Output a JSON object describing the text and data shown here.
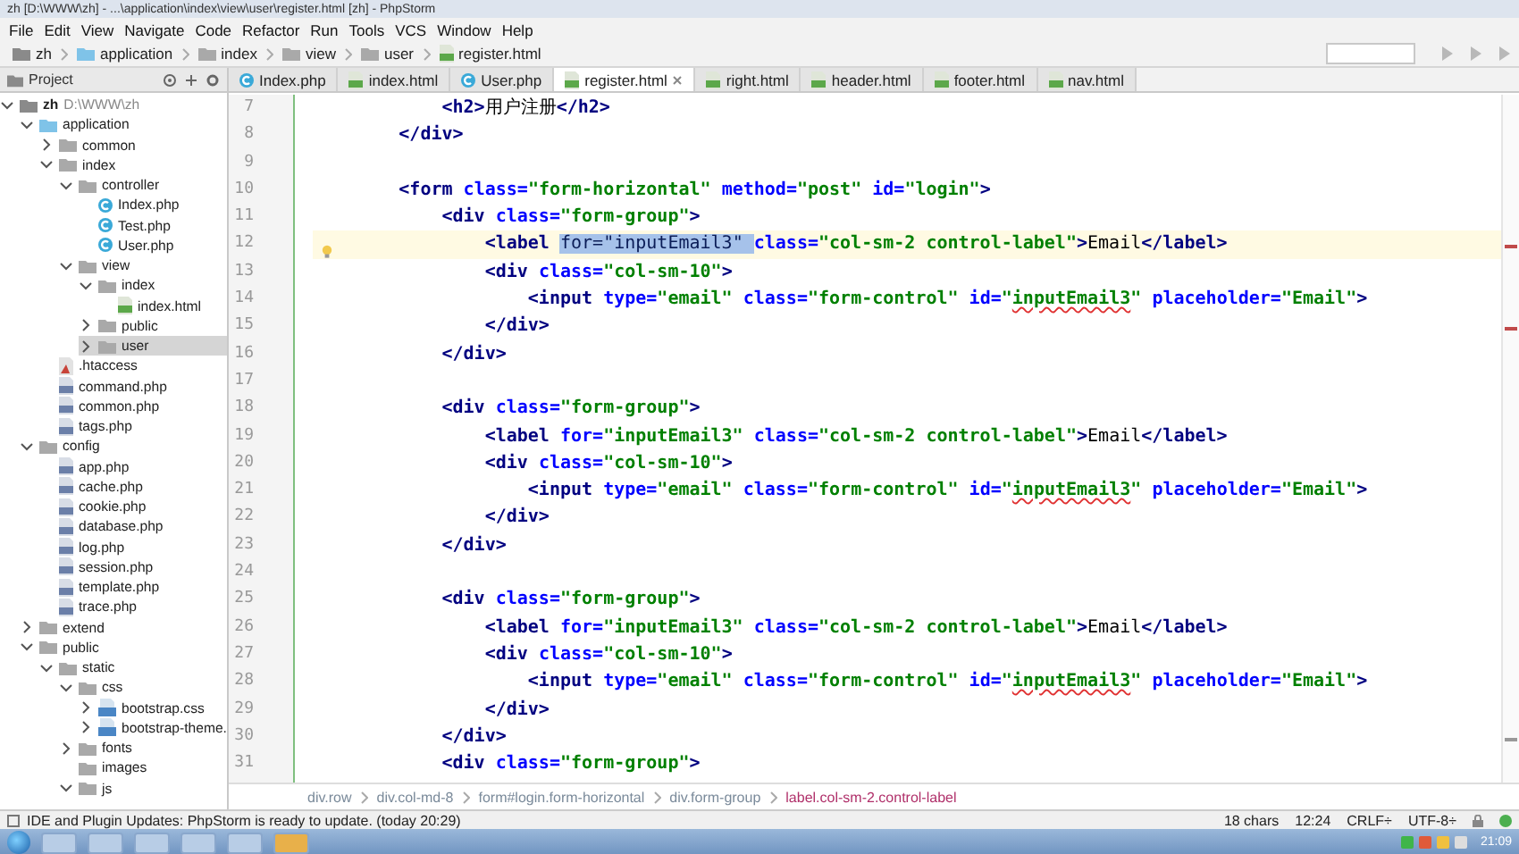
{
  "window": {
    "title": "zh [D:\\WWW\\zh] - ...\\application\\index\\view\\user\\register.html [zh] - PhpStorm"
  },
  "menu": [
    "File",
    "Edit",
    "View",
    "Navigate",
    "Code",
    "Refactor",
    "Run",
    "Tools",
    "VCS",
    "Window",
    "Help"
  ],
  "navigation_bar": [
    {
      "label": "zh",
      "kind": "project"
    },
    {
      "label": "application",
      "kind": "module"
    },
    {
      "label": "index",
      "kind": "folder"
    },
    {
      "label": "view",
      "kind": "folder"
    },
    {
      "label": "user",
      "kind": "folder"
    },
    {
      "label": "register.html",
      "kind": "html"
    }
  ],
  "project_panel": {
    "title": "Project"
  },
  "tabs": [
    {
      "label": "Index.php",
      "kind": "php-class",
      "selected": false
    },
    {
      "label": "index.html",
      "kind": "html",
      "selected": false
    },
    {
      "label": "User.php",
      "kind": "php-class",
      "selected": false
    },
    {
      "label": "register.html",
      "kind": "html",
      "selected": true
    },
    {
      "label": "right.html",
      "kind": "html",
      "selected": false
    },
    {
      "label": "header.html",
      "kind": "html",
      "selected": false
    },
    {
      "label": "footer.html",
      "kind": "html",
      "selected": false
    },
    {
      "label": "nav.html",
      "kind": "html",
      "selected": false
    }
  ],
  "tree": [
    {
      "label": "zh",
      "path": "D:\\WWW\\zh",
      "kind": "project",
      "expanded": true,
      "selected": false,
      "children": [
        {
          "label": "application",
          "kind": "module",
          "expanded": true,
          "selected": false,
          "children": [
            {
              "label": "common",
              "kind": "folder",
              "expanded": false,
              "selected": false
            },
            {
              "label": "index",
              "kind": "folder",
              "expanded": true,
              "selected": false,
              "children": [
                {
                  "label": "controller",
                  "kind": "folder",
                  "expanded": true,
                  "selected": false,
                  "children": [
                    {
                      "label": "Index.php",
                      "kind": "php-class",
                      "selected": false
                    },
                    {
                      "label": "Test.php",
                      "kind": "php-class",
                      "selected": false
                    },
                    {
                      "label": "User.php",
                      "kind": "php-class",
                      "selected": false
                    }
                  ]
                },
                {
                  "label": "view",
                  "kind": "folder",
                  "expanded": true,
                  "selected": false,
                  "children": [
                    {
                      "label": "index",
                      "kind": "folder",
                      "expanded": true,
                      "selected": false,
                      "children": [
                        {
                          "label": "index.html",
                          "kind": "html",
                          "selected": false
                        }
                      ]
                    },
                    {
                      "label": "public",
                      "kind": "folder",
                      "expanded": false,
                      "selected": false
                    },
                    {
                      "label": "user",
                      "kind": "folder",
                      "expanded": false,
                      "selected": true
                    }
                  ]
                }
              ]
            },
            {
              "label": ".htaccess",
              "kind": "htaccess",
              "selected": false
            },
            {
              "label": "command.php",
              "kind": "php",
              "selected": false
            },
            {
              "label": "common.php",
              "kind": "php",
              "selected": false
            },
            {
              "label": "tags.php",
              "kind": "php",
              "selected": false
            }
          ]
        },
        {
          "label": "config",
          "kind": "folder",
          "expanded": true,
          "selected": false,
          "children": [
            {
              "label": "app.php",
              "kind": "php",
              "selected": false
            },
            {
              "label": "cache.php",
              "kind": "php",
              "selected": false
            },
            {
              "label": "cookie.php",
              "kind": "php",
              "selected": false
            },
            {
              "label": "database.php",
              "kind": "php",
              "selected": false
            },
            {
              "label": "log.php",
              "kind": "php",
              "selected": false
            },
            {
              "label": "session.php",
              "kind": "php",
              "selected": false
            },
            {
              "label": "template.php",
              "kind": "php",
              "selected": false
            },
            {
              "label": "trace.php",
              "kind": "php",
              "selected": false
            }
          ]
        },
        {
          "label": "extend",
          "kind": "folder",
          "expanded": false,
          "selected": false
        },
        {
          "label": "public",
          "kind": "folder",
          "expanded": true,
          "selected": false,
          "children": [
            {
              "label": "static",
              "kind": "folder",
              "expanded": true,
              "selected": false,
              "children": [
                {
                  "label": "css",
                  "kind": "folder",
                  "expanded": true,
                  "selected": false,
                  "children": [
                    {
                      "label": "bootstrap.css",
                      "kind": "css",
                      "expanded": false,
                      "selected": false
                    },
                    {
                      "label": "bootstrap-theme.",
                      "kind": "css",
                      "expanded": false,
                      "selected": false
                    }
                  ]
                },
                {
                  "label": "fonts",
                  "kind": "folder",
                  "expanded": false,
                  "selected": false
                },
                {
                  "label": "images",
                  "kind": "folder",
                  "selected": false
                },
                {
                  "label": "js",
                  "kind": "folder",
                  "expanded": true,
                  "selected": false
                }
              ]
            }
          ]
        }
      ]
    }
  ],
  "editor": {
    "lines": [
      {
        "number": "7",
        "current": false,
        "tokens": [
          {
            "kind": "tag",
            "text": "            <h2>"
          },
          {
            "kind": "text",
            "text": "用户注册"
          },
          {
            "kind": "tag",
            "text": "</h2>"
          }
        ]
      },
      {
        "number": "8",
        "current": false,
        "tokens": [
          {
            "kind": "tag",
            "text": "        </div>"
          }
        ]
      },
      {
        "number": "9",
        "current": false
      },
      {
        "number": "10",
        "current": false,
        "tokens": [
          {
            "kind": "tag",
            "text": "        <form"
          },
          {
            "kind": "attr",
            "text": " class="
          },
          {
            "kind": "value",
            "text": "\"form-horizontal\""
          },
          {
            "kind": "attr",
            "text": " method="
          },
          {
            "kind": "value",
            "text": "\"post\""
          },
          {
            "kind": "attr",
            "text": " id="
          },
          {
            "kind": "value",
            "text": "\"login\""
          },
          {
            "kind": "tag",
            "text": ">"
          }
        ]
      },
      {
        "number": "11",
        "current": false,
        "tokens": [
          {
            "kind": "tag",
            "text": "            <div"
          },
          {
            "kind": "attr",
            "text": " class="
          },
          {
            "kind": "value",
            "text": "\"form-group\""
          },
          {
            "kind": "tag",
            "text": ">"
          }
        ]
      },
      {
        "number": "12",
        "current": true,
        "tokens": [
          {
            "kind": "tag",
            "text": "                <label "
          },
          {
            "kind": "selection",
            "text": "for=\"inputEmail3\" "
          },
          {
            "kind": "attr",
            "text": "class="
          },
          {
            "kind": "value",
            "text": "\"col-sm-2 control-label\""
          },
          {
            "kind": "tag",
            "text": ">"
          },
          {
            "kind": "text",
            "text": "Email"
          },
          {
            "kind": "tag",
            "text": "</label>"
          }
        ]
      },
      {
        "number": "13",
        "current": false,
        "tokens": [
          {
            "kind": "tag",
            "text": "                <div"
          },
          {
            "kind": "attr",
            "text": " class="
          },
          {
            "kind": "value",
            "text": "\"col-sm-10\""
          },
          {
            "kind": "tag",
            "text": ">"
          }
        ]
      },
      {
        "number": "14",
        "current": false,
        "tokens": [
          {
            "kind": "tag",
            "text": "                    <input"
          },
          {
            "kind": "attr",
            "text": " type="
          },
          {
            "kind": "value",
            "text": "\"email\""
          },
          {
            "kind": "attr",
            "text": " class="
          },
          {
            "kind": "value",
            "text": "\"form-control\""
          },
          {
            "kind": "attr",
            "text": " id="
          },
          {
            "kind": "value",
            "text": "\""
          },
          {
            "kind": "typo",
            "text": "inputEmail3"
          },
          {
            "kind": "value",
            "text": "\""
          },
          {
            "kind": "attr",
            "text": " placeholder="
          },
          {
            "kind": "value",
            "text": "\"Email\""
          },
          {
            "kind": "tag",
            "text": ">"
          }
        ]
      },
      {
        "number": "15",
        "current": false,
        "tokens": [
          {
            "kind": "tag",
            "text": "                </div>"
          }
        ]
      },
      {
        "number": "16",
        "current": false,
        "tokens": [
          {
            "kind": "tag",
            "text": "            </div>"
          }
        ]
      },
      {
        "number": "17",
        "current": false
      },
      {
        "number": "18",
        "current": false,
        "tokens": [
          {
            "kind": "tag",
            "text": "            <div"
          },
          {
            "kind": "attr",
            "text": " class="
          },
          {
            "kind": "value",
            "text": "\"form-group\""
          },
          {
            "kind": "tag",
            "text": ">"
          }
        ]
      },
      {
        "number": "19",
        "current": false,
        "tokens": [
          {
            "kind": "tag",
            "text": "                <label"
          },
          {
            "kind": "attr",
            "text": " for="
          },
          {
            "kind": "value",
            "text": "\"inputEmail3\""
          },
          {
            "kind": "attr",
            "text": " class="
          },
          {
            "kind": "value",
            "text": "\"col-sm-2 control-label\""
          },
          {
            "kind": "tag",
            "text": ">"
          },
          {
            "kind": "text",
            "text": "Email"
          },
          {
            "kind": "tag",
            "text": "</label>"
          }
        ]
      },
      {
        "number": "20",
        "current": false,
        "tokens": [
          {
            "kind": "tag",
            "text": "                <div"
          },
          {
            "kind": "attr",
            "text": " class="
          },
          {
            "kind": "value",
            "text": "\"col-sm-10\""
          },
          {
            "kind": "tag",
            "text": ">"
          }
        ]
      },
      {
        "number": "21",
        "current": false,
        "tokens": [
          {
            "kind": "tag",
            "text": "                    <input"
          },
          {
            "kind": "attr",
            "text": " type="
          },
          {
            "kind": "value",
            "text": "\"email\""
          },
          {
            "kind": "attr",
            "text": " class="
          },
          {
            "kind": "value",
            "text": "\"form-control\""
          },
          {
            "kind": "attr",
            "text": " id="
          },
          {
            "kind": "value",
            "text": "\""
          },
          {
            "kind": "typo",
            "text": "inputEmail3"
          },
          {
            "kind": "value",
            "text": "\""
          },
          {
            "kind": "attr",
            "text": " placeholder="
          },
          {
            "kind": "value",
            "text": "\"Email\""
          },
          {
            "kind": "tag",
            "text": ">"
          }
        ]
      },
      {
        "number": "22",
        "current": false,
        "tokens": [
          {
            "kind": "tag",
            "text": "                </div>"
          }
        ]
      },
      {
        "number": "23",
        "current": false,
        "tokens": [
          {
            "kind": "tag",
            "text": "            </div>"
          }
        ]
      },
      {
        "number": "24",
        "current": false
      },
      {
        "number": "25",
        "current": false,
        "tokens": [
          {
            "kind": "tag",
            "text": "            <div"
          },
          {
            "kind": "attr",
            "text": " class="
          },
          {
            "kind": "value",
            "text": "\"form-group\""
          },
          {
            "kind": "tag",
            "text": ">"
          }
        ]
      },
      {
        "number": "26",
        "current": false,
        "tokens": [
          {
            "kind": "tag",
            "text": "                <label"
          },
          {
            "kind": "attr",
            "text": " for="
          },
          {
            "kind": "value",
            "text": "\"inputEmail3\""
          },
          {
            "kind": "attr",
            "text": " class="
          },
          {
            "kind": "value",
            "text": "\"col-sm-2 control-label\""
          },
          {
            "kind": "tag",
            "text": ">"
          },
          {
            "kind": "text",
            "text": "Email"
          },
          {
            "kind": "tag",
            "text": "</label>"
          }
        ]
      },
      {
        "number": "27",
        "current": false,
        "tokens": [
          {
            "kind": "tag",
            "text": "                <div"
          },
          {
            "kind": "attr",
            "text": " class="
          },
          {
            "kind": "value",
            "text": "\"col-sm-10\""
          },
          {
            "kind": "tag",
            "text": ">"
          }
        ]
      },
      {
        "number": "28",
        "current": false,
        "tokens": [
          {
            "kind": "tag",
            "text": "                    <input"
          },
          {
            "kind": "attr",
            "text": " type="
          },
          {
            "kind": "value",
            "text": "\"email\""
          },
          {
            "kind": "attr",
            "text": " class="
          },
          {
            "kind": "value",
            "text": "\"form-control\""
          },
          {
            "kind": "attr",
            "text": " id="
          },
          {
            "kind": "value",
            "text": "\""
          },
          {
            "kind": "typo",
            "text": "inputEmail3"
          },
          {
            "kind": "value",
            "text": "\""
          },
          {
            "kind": "attr",
            "text": " placeholder="
          },
          {
            "kind": "value",
            "text": "\"Email\""
          },
          {
            "kind": "tag",
            "text": ">"
          }
        ]
      },
      {
        "number": "29",
        "current": false,
        "tokens": [
          {
            "kind": "tag",
            "text": "                </div>"
          }
        ]
      },
      {
        "number": "30",
        "current": false,
        "tokens": [
          {
            "kind": "tag",
            "text": "            </div>"
          }
        ]
      },
      {
        "number": "31",
        "current": false,
        "tokens": [
          {
            "kind": "tag",
            "text": "            <div"
          },
          {
            "kind": "attr",
            "text": " class="
          },
          {
            "kind": "value",
            "text": "\"form-group\""
          },
          {
            "kind": "tag",
            "text": ">"
          }
        ]
      }
    ]
  },
  "breadcrumbs": [
    {
      "label": "div.row",
      "selected": false
    },
    {
      "label": "div.col-md-8",
      "selected": false
    },
    {
      "label": "form#login.form-horizontal",
      "selected": false
    },
    {
      "label": "div.form-group",
      "selected": false
    },
    {
      "label": "label.col-sm-2.control-label",
      "selected": true
    }
  ],
  "status_bar": {
    "message": "IDE and Plugin Updates: PhpStorm is ready to update. (today 20:29)",
    "fields": [
      "18 chars",
      "12:24",
      "CRLF÷",
      "UTF-8÷"
    ]
  },
  "taskbar": {
    "clock": "21:09"
  }
}
